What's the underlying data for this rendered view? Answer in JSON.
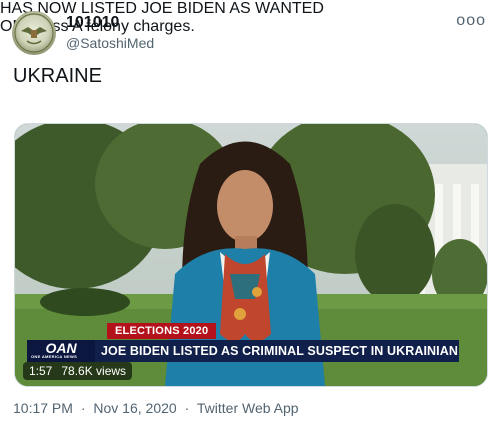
{
  "tweet": {
    "display_name": "101010",
    "handle": "@SatoshiMed",
    "text_line1": "UKRAINE",
    "text_line1_rest": " HAS NOW LISTED JOE BIDEN AS WANTED",
    "text_line2": "ON Class A felony charges.",
    "more_icon": "ooo"
  },
  "video": {
    "tag": "ELECTIONS 2020",
    "network_logo": "OAN",
    "network_sub": "ONE AMERICA NEWS",
    "headline": "JOE BIDEN LISTED AS CRIMINAL SUSPECT IN UKRAINIAN COURT",
    "duration": "1:57",
    "views": "78.6K views"
  },
  "footer": {
    "time": "10:17 PM",
    "separator": "·",
    "date": "Nov 16, 2020",
    "separator2": "·",
    "source": "Twitter Web App"
  },
  "colors": {
    "chyron_red": "#b3121a",
    "chyron_navy": "#11204a",
    "ukraine_blue": "#0057b7",
    "ukraine_yellow": "#ffd700"
  }
}
